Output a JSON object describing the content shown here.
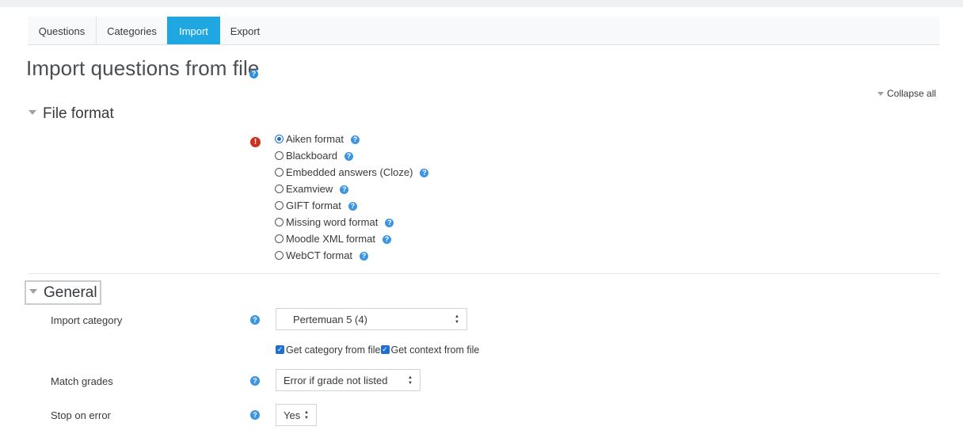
{
  "tabs": [
    {
      "label": "Questions",
      "active": false
    },
    {
      "label": "Categories",
      "active": false
    },
    {
      "label": "Import",
      "active": true
    },
    {
      "label": "Export",
      "active": false
    }
  ],
  "page_title": "Import questions from file",
  "collapse_all": "Collapse all",
  "sections": {
    "file_format": {
      "title": "File format",
      "options": [
        {
          "label": "Aiken format",
          "checked": true
        },
        {
          "label": "Blackboard",
          "checked": false
        },
        {
          "label": "Embedded answers (Cloze)",
          "checked": false
        },
        {
          "label": "Examview",
          "checked": false
        },
        {
          "label": "GIFT format",
          "checked": false
        },
        {
          "label": "Missing word format",
          "checked": false
        },
        {
          "label": "Moodle XML format",
          "checked": false
        },
        {
          "label": "WebCT format",
          "checked": false
        }
      ]
    },
    "general": {
      "title": "General",
      "import_category": {
        "label": "Import category",
        "value": "Pertemuan 5 (4)"
      },
      "checkboxes": {
        "category_from_file": {
          "label": "Get category from file",
          "checked": true
        },
        "context_from_file": {
          "label": "Get context from file",
          "checked": true
        }
      },
      "match_grades": {
        "label": "Match grades",
        "value": "Error if grade not listed"
      },
      "stop_on_error": {
        "label": "Stop on error",
        "value": "Yes"
      }
    }
  },
  "colors": {
    "accent": "#1ea7e1",
    "help": "#3b95e0",
    "required": "#ca3120",
    "check": "#1f6fd1"
  },
  "icons": {
    "help": "question-circle",
    "required": "exclamation-circle",
    "collapse": "triangle-down",
    "select": "up-down-chevron"
  }
}
